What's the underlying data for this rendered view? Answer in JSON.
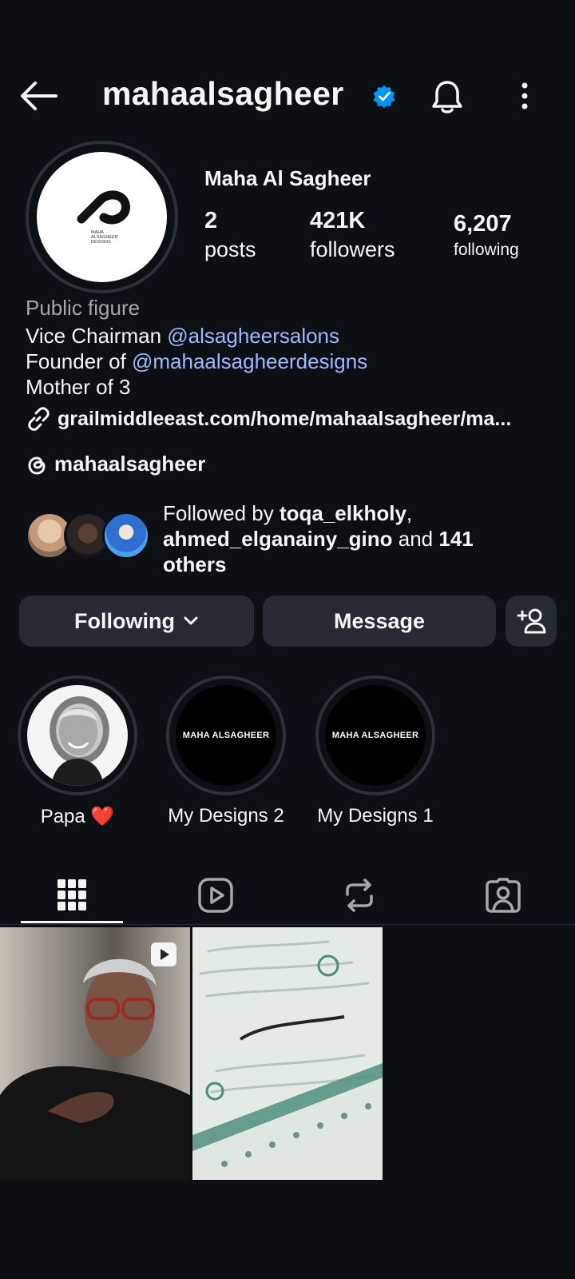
{
  "header": {
    "username": "mahaalsagheer"
  },
  "profile": {
    "display_name": "Maha Al Sagheer",
    "stats": {
      "posts_count": "2",
      "posts_label": "posts",
      "followers_count": "421K",
      "followers_label": "followers",
      "following_count": "6,207",
      "following_label": "following"
    },
    "avatar_logo_text": [
      "MAHA",
      "ALSAGHEER",
      "DESIGNS"
    ]
  },
  "bio": {
    "category": "Public figure",
    "line1_prefix": "Vice Chairman ",
    "line1_mention": "@alsagheersalons",
    "line2_prefix": "Founder of ",
    "line2_mention": "@mahaalsagheerdesigns",
    "line3": "Mother of 3",
    "link": "grailmiddleeast.com/home/mahaalsagheer/ma...",
    "threads_handle": "mahaalsagheer"
  },
  "followed_by": {
    "prefix": "Followed by ",
    "user1": "toqa_elkholy",
    "separator": ",",
    "user2": "ahmed_elganainy_gino",
    "and_text": " and ",
    "count": "141",
    "others": "others"
  },
  "actions": {
    "following_label": "Following",
    "message_label": "Message"
  },
  "highlights": [
    {
      "label": "Papa ❤️"
    },
    {
      "label": "My Designs 2",
      "cover_text": "MAHA ALSAGHEER"
    },
    {
      "label": "My Designs 1",
      "cover_text": "MAHA ALSAGHEER"
    }
  ],
  "posts": [
    {
      "type": "reel",
      "icon": "reel-icon"
    },
    {
      "type": "image"
    }
  ],
  "colors": {
    "background": "#0c1014",
    "button": "#262b33",
    "mention": "#a4b8ff",
    "verified": "#0095f6",
    "secondary_text": "#a8a8a8"
  }
}
